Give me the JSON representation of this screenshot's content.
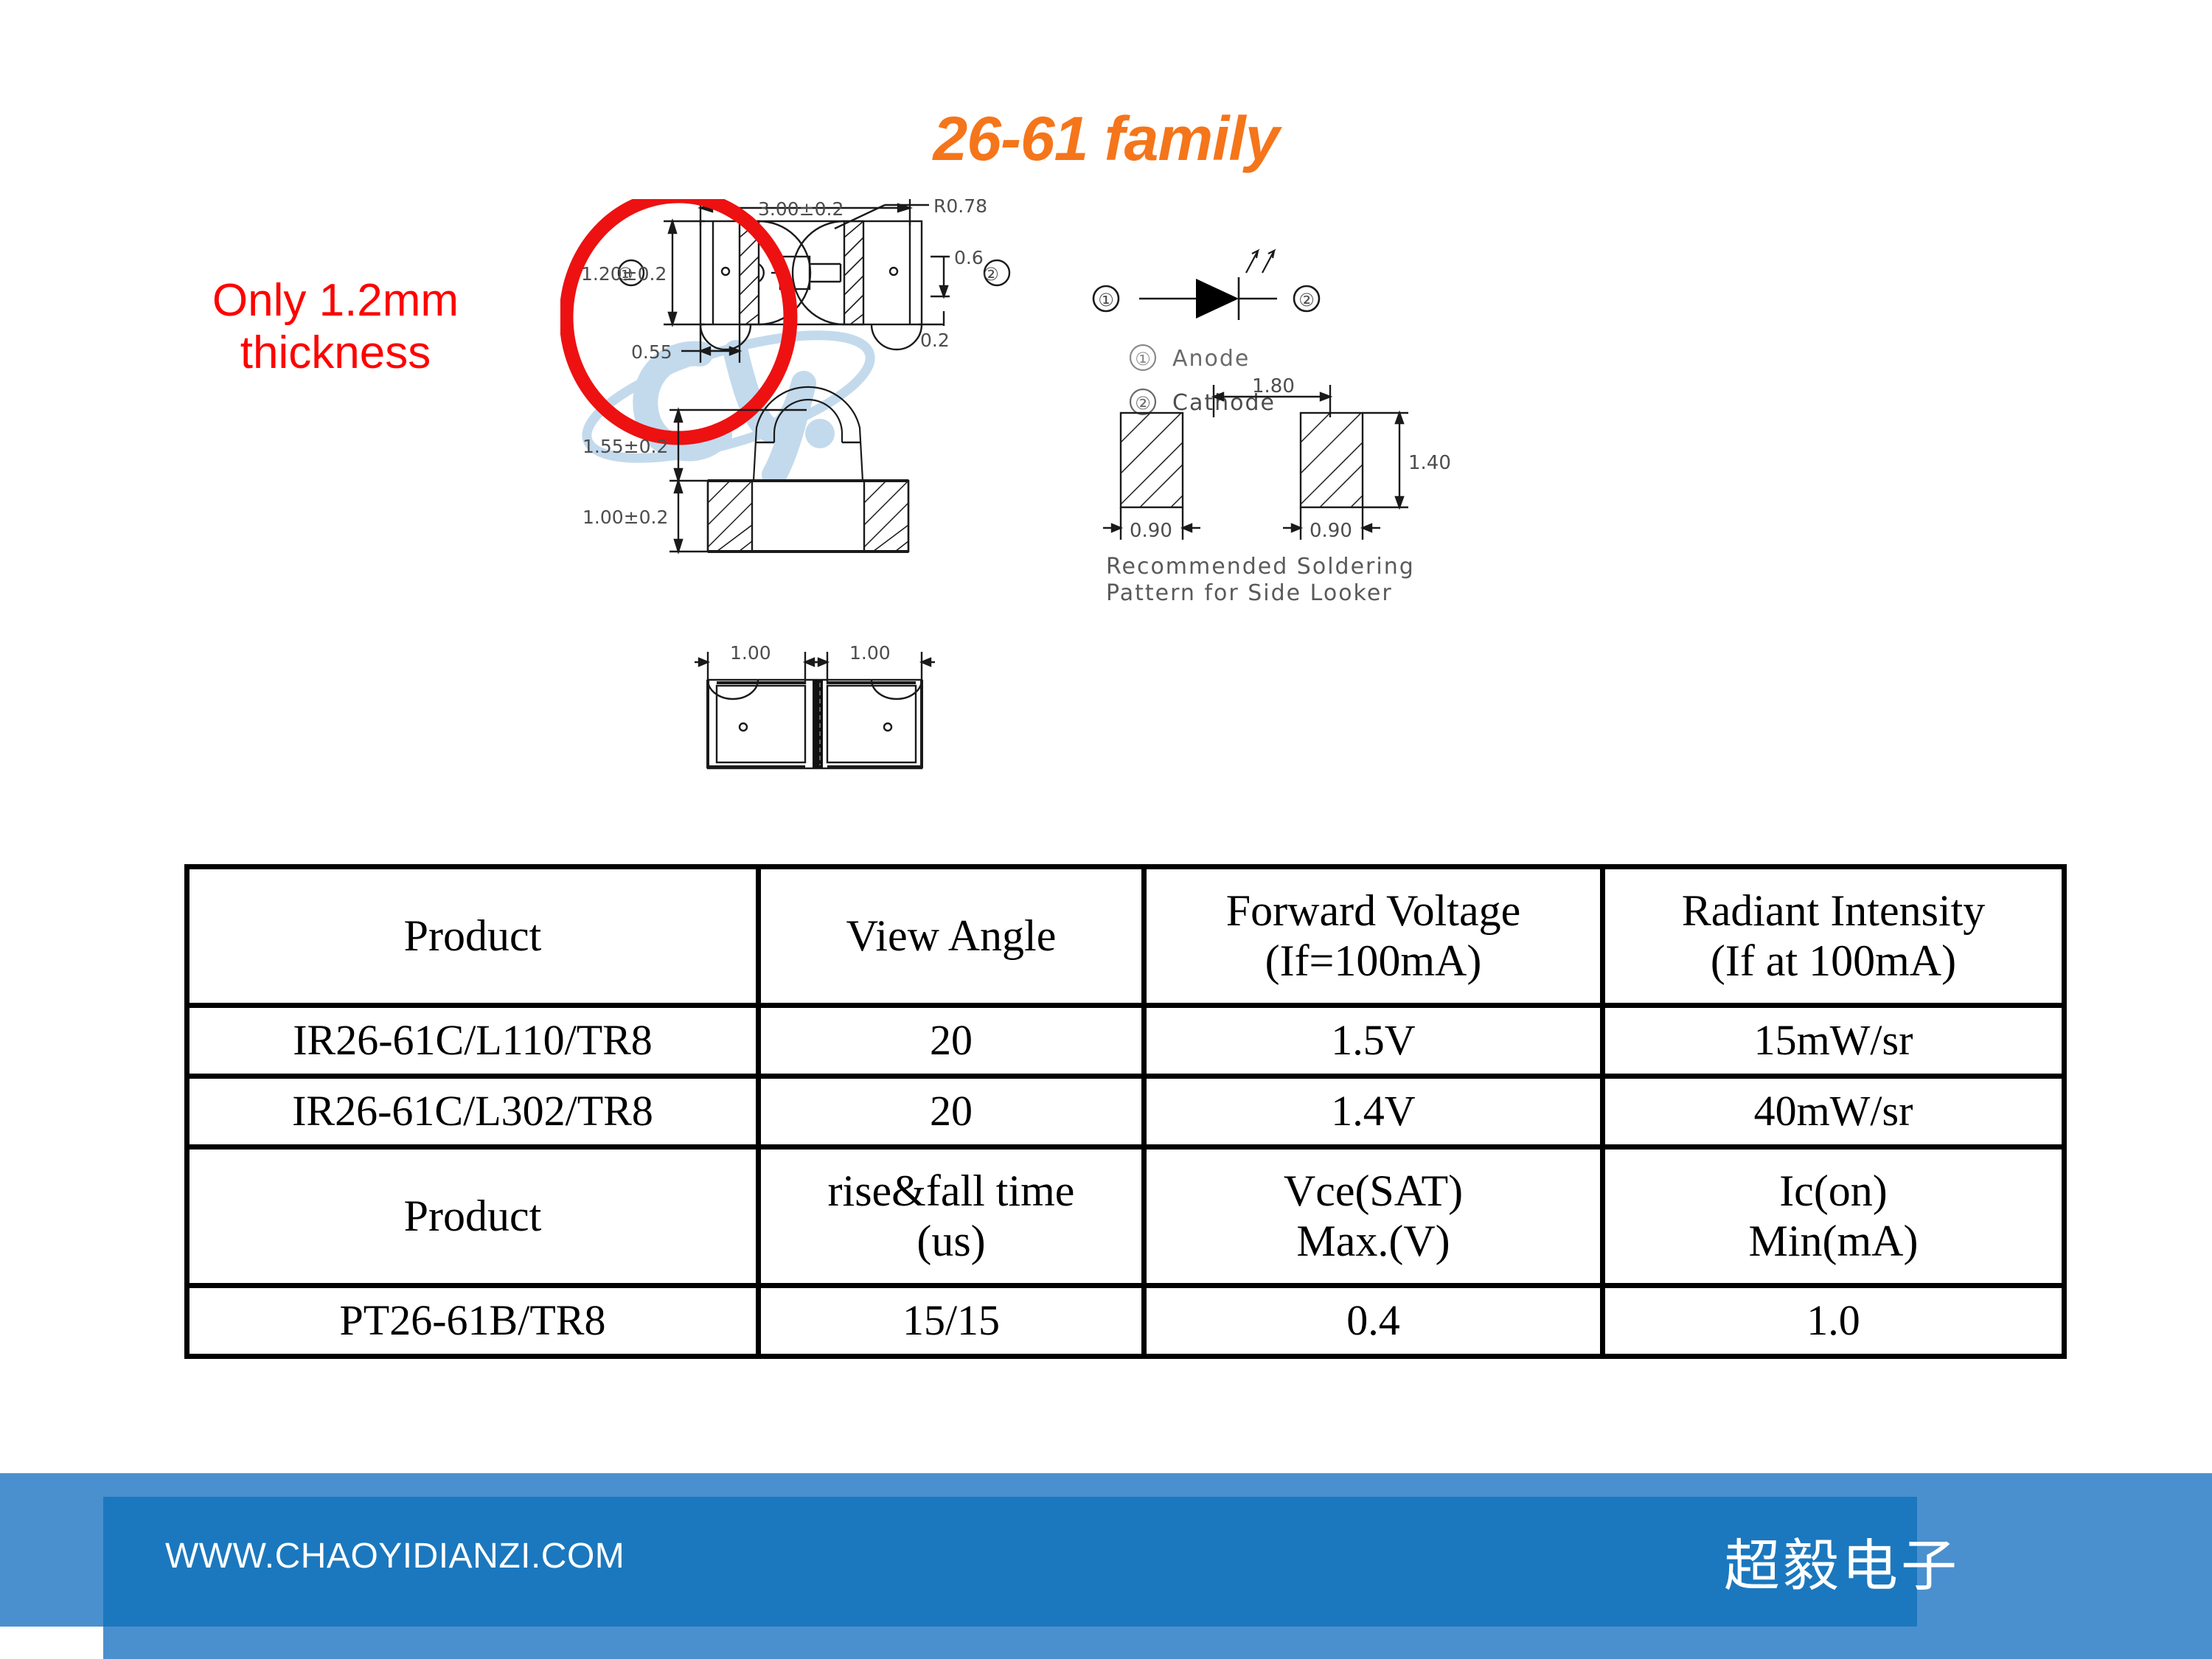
{
  "title": "26-61 family",
  "callout": {
    "line1": "Only 1.2mm",
    "line2": "thickness"
  },
  "drawing": {
    "top_view": {
      "width_dim": "3.00±0.2",
      "height_dim": "1.20±0.2",
      "radius_dim": "R0.78",
      "lead_dim": "0.6",
      "lead_dim2": "0.2",
      "offset_dim": "0.55",
      "pin1_label": "①",
      "pin2_label": "②"
    },
    "side_view": {
      "total_height_dim": "1.55±0.2",
      "body_height_dim": "1.00±0.2"
    },
    "bottom_view": {
      "left_dim": "1.00",
      "right_dim": "1.00"
    },
    "schematic": {
      "pin1_label": "①",
      "pin2_label": "②",
      "legend1_marker": "①",
      "legend1_text": "Anode",
      "legend2_marker": "②",
      "legend2_text": "Cathode"
    },
    "solder_pattern": {
      "pitch_dim": "1.80",
      "pad_height_dim": "1.40",
      "pad_width_left_dim": "0.90",
      "pad_width_right_dim": "0.90",
      "caption_line1": "Recommended Soldering",
      "caption_line2": "Pattern for Side Looker"
    },
    "watermark_text": "CY"
  },
  "table": {
    "led_header": [
      "Product",
      "View Angle",
      "Forward Voltage\n(If=100mA)",
      "Radiant Intensity\n(If at 100mA)"
    ],
    "led_header_cells": [
      {
        "line1": "Product",
        "line2": ""
      },
      {
        "line1": "View Angle",
        "line2": ""
      },
      {
        "line1": "Forward Voltage",
        "line2": "(If=100mA)"
      },
      {
        "line1": "Radiant Intensity",
        "line2": "(If at 100mA)"
      }
    ],
    "led_rows": [
      {
        "product": "IR26-61C/L110/TR8",
        "view_angle": "20",
        "forward_voltage": "1.5V",
        "radiant_intensity": "15mW/sr"
      },
      {
        "product": "IR26-61C/L302/TR8",
        "view_angle": "20",
        "forward_voltage": "1.4V",
        "radiant_intensity": "40mW/sr"
      }
    ],
    "pt_header_cells": [
      {
        "line1": "Product",
        "line2": ""
      },
      {
        "line1": "rise&fall time",
        "line2": "(us)"
      },
      {
        "line1": "Vce(SAT)",
        "line2": "Max.(V)"
      },
      {
        "line1": "Ic(on)",
        "line2": "Min(mA)"
      }
    ],
    "pt_rows": [
      {
        "product": "PT26-61B/TR8",
        "rise_fall": "15/15",
        "vce_sat": "0.4",
        "ic_on": "1.0"
      }
    ]
  },
  "footer": {
    "url": "WWW.CHAOYIDIANZI.COM",
    "brand": "超毅电子"
  },
  "colors": {
    "title_orange": "#F5751A",
    "callout_red": "#FF0000",
    "footer_light_blue": "#4A90CE",
    "footer_dark_blue": "#1B78BE",
    "watermark_blue": "#B9D4EA"
  }
}
